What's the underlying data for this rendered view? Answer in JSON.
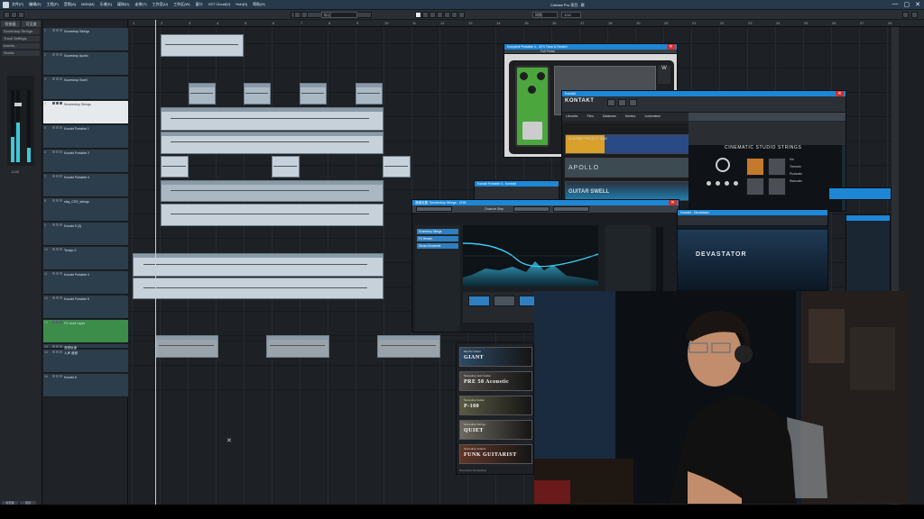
{
  "window": {
    "title": "Cubase Pro 项目 - 歌",
    "controls": [
      "—",
      "▢",
      "✕"
    ]
  },
  "menu": {
    "items": [
      "文件(F)",
      "编辑(E)",
      "工程(P)",
      "音频(A)",
      "MIDI(M)",
      "乐谱(S)",
      "媒体(D)",
      "走带(T)",
      "工作室(U)",
      "工作区(W)",
      "窗口",
      "VST Cloud(V)",
      "Hub(H)",
      "帮助(H)"
    ]
  },
  "toolbar": {
    "selectors": [
      "标记",
      "网格",
      "1/16"
    ]
  },
  "inspector": {
    "tabs": [
      "检查器",
      "可见度"
    ],
    "rows": [
      "Scoredrop Strings",
      "Track Settings",
      "Inserts",
      "Sends"
    ],
    "meter_levels": [
      0.35,
      0.55,
      0.2
    ],
    "fader_value": "-0.00",
    "bottom_tabs": [
      "检查器",
      "通道"
    ]
  },
  "tracks": [
    {
      "num": "1",
      "name": "Scoredrop Strings",
      "kind": "folder"
    },
    {
      "num": "2",
      "name": "Scoredrop Apollo",
      "kind": "normal"
    },
    {
      "num": "3",
      "name": "Scoredrop Swell",
      "kind": "normal"
    },
    {
      "num": "4",
      "name": "Smokedrop Strings",
      "kind": "selected"
    },
    {
      "num": "5",
      "name": "Konakt Portable 1",
      "kind": "normal"
    },
    {
      "num": "6",
      "name": "Konakt Portable 2",
      "kind": "normal"
    },
    {
      "num": "7",
      "name": "Konakt Portable 3",
      "kind": "normal"
    },
    {
      "num": "8",
      "name": "stay_CSS_strings",
      "kind": "normal"
    },
    {
      "num": "9",
      "name": "Konakt 5 (3)",
      "kind": "normal"
    },
    {
      "num": "10",
      "name": "Tempo 2",
      "kind": "normal"
    },
    {
      "num": "11",
      "name": "Konakt Portable 4",
      "kind": "normal"
    },
    {
      "num": "12",
      "name": "Konakt Portable 5",
      "kind": "normal"
    },
    {
      "num": "13",
      "name": "FX Lead Layer",
      "kind": "green"
    },
    {
      "num": "14",
      "name": "音频轨道",
      "kind": "folder"
    },
    {
      "num": "15",
      "name": "人声 音频",
      "kind": "normal"
    },
    {
      "num": "16",
      "name": "Konakt 6",
      "kind": "normal"
    }
  ],
  "ruler": {
    "labels": [
      "1",
      "2",
      "3",
      "4",
      "5",
      "6",
      "7",
      "8",
      "9",
      "10",
      "11",
      "12",
      "13",
      "14",
      "15",
      "16",
      "17",
      "18",
      "19",
      "20",
      "21",
      "22",
      "23",
      "24",
      "25",
      "26",
      "27",
      "28"
    ]
  },
  "plugins": {
    "pedal": {
      "title": "Komplete Portable 4 - GFX Trem & Reverb",
      "preset": "Full Pedal"
    },
    "kontakt": {
      "title": "Kontakt",
      "tabs": [
        "Libraries",
        "Files",
        "Database",
        "Monitor",
        "Automation"
      ],
      "slots": [
        "SCARBEE  PROJECT SAM",
        "APOLLO",
        "GUITAR SWELL"
      ],
      "instrument": "CINEMATIC STUDIO STRINGS",
      "side_labels": [
        "Vln",
        "Tremolo",
        "Pizzicato",
        "Staccato"
      ]
    },
    "kontakt_small": {
      "title": "Konakt Portable 4 - Kontakt"
    },
    "eq": {
      "title": "通道设置: Smokedrop Strings - CHN",
      "inserts": [
        "Scoredrop Strings",
        "FX Reverb",
        "Stereo Ensemble"
      ],
      "header": "Channel Strip"
    },
    "devastator": {
      "title": "Kontakt - Devastator",
      "name": "DEVASTATOR"
    }
  },
  "presets": [
    {
      "sub": "Electric Guitar",
      "name": "GIANT",
      "color": "#2d4a66"
    },
    {
      "sub": "Scoredrop Jazz Guitar",
      "name": "PRE 58 Acoustic",
      "color": "#4d4a45"
    },
    {
      "sub": "Scoredrop Guitar",
      "name": "P-100",
      "color": "#5a5a44"
    },
    {
      "sub": "Scoredrop Strings",
      "name": "QUIET",
      "color": "#6e6a60"
    },
    {
      "sub": "Scoredrop Guitars",
      "name": "FUNK GUITARIST",
      "color": "#613628"
    }
  ],
  "presets_footer": "Scoredrop Smokedrop",
  "colors": {
    "accent": "#1d87d6",
    "clip": "#aab8c4",
    "green_track": "#3c8c4a",
    "eq_cyan": "#2fb9e3"
  }
}
